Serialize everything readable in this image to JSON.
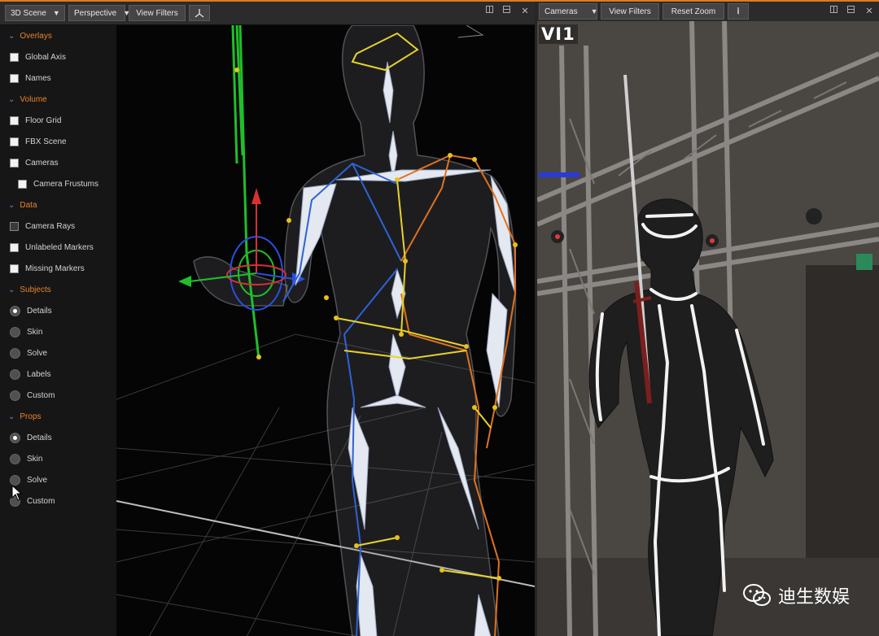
{
  "left": {
    "scene_dropdown": "3D Scene",
    "view_dropdown": "Perspective",
    "view_filters": "View Filters",
    "sidebar": {
      "overlays": {
        "title": "Overlays",
        "items": [
          "Global Axis",
          "Names"
        ]
      },
      "volume": {
        "title": "Volume",
        "items": [
          "Floor Grid",
          "FBX Scene",
          "Cameras",
          "Camera Frustums"
        ]
      },
      "data": {
        "title": "Data",
        "items": [
          "Camera Rays",
          "Unlabeled Markers",
          "Missing Markers"
        ]
      },
      "subjects": {
        "title": "Subjects",
        "items": [
          "Details",
          "Skin",
          "Solve",
          "Labels",
          "Custom"
        ],
        "selected": "Details"
      },
      "props": {
        "title": "Props",
        "items": [
          "Details",
          "Skin",
          "Solve",
          "Custom"
        ],
        "selected": "Details"
      }
    }
  },
  "right": {
    "cameras_dropdown": "Cameras",
    "view_filters": "View Filters",
    "reset_zoom": "Reset Zoom",
    "camera_label": "VI1"
  },
  "watermark": {
    "text": "迪生数娱",
    "icon": "wechat-icon"
  },
  "colors": {
    "accent": "#e07a1e",
    "section_title": "#e8832c",
    "chevron": "#5b8fd8",
    "left_skeleton": "#2e63d6",
    "right_skeleton": "#e0721e",
    "spine": "#e6d32a"
  }
}
